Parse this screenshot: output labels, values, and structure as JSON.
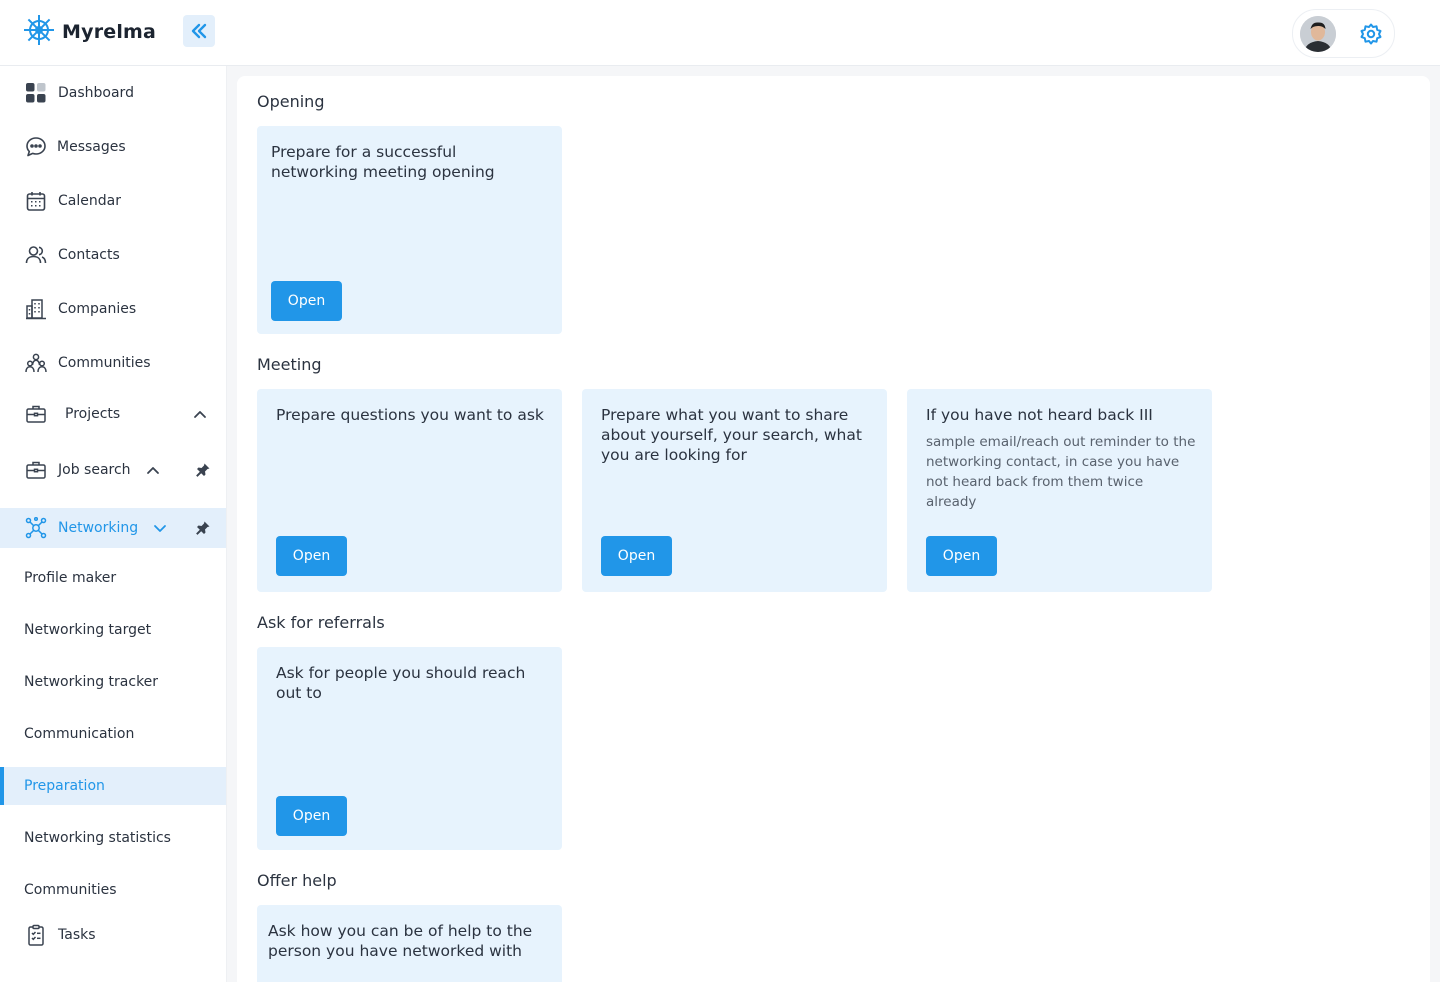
{
  "app": {
    "name": "Myrelma"
  },
  "colors": {
    "accent": "#2196e8",
    "accent_light": "#e3effb",
    "card_bg": "#e7f3fd"
  },
  "sidebar": {
    "items": [
      {
        "label": "Dashboard",
        "icon": "dashboard-icon"
      },
      {
        "label": "Messages",
        "icon": "chat-bubble-icon"
      },
      {
        "label": "Calendar",
        "icon": "calendar-icon"
      },
      {
        "label": "Contacts",
        "icon": "users-icon"
      },
      {
        "label": "Companies",
        "icon": "building-icon"
      },
      {
        "label": "Communities",
        "icon": "community-icon"
      },
      {
        "label": "Projects",
        "icon": "briefcase-icon"
      },
      {
        "label": "Job search",
        "icon": "briefcase-icon"
      },
      {
        "label": "Networking",
        "icon": "network-icon"
      }
    ],
    "networking_sub": [
      "Profile maker",
      "Networking target",
      "Networking tracker",
      "Communication",
      "Preparation",
      "Networking statistics",
      "Communities"
    ],
    "tasks": {
      "label": "Tasks",
      "icon": "clipboard-checklist-icon"
    }
  },
  "sections": [
    {
      "title": "Opening",
      "cards": [
        {
          "title": "Prepare for a successful networking meeting opening",
          "description": "",
          "button": "Open"
        }
      ]
    },
    {
      "title": "Meeting",
      "cards": [
        {
          "title": "Prepare questions you want to ask",
          "description": "",
          "button": "Open"
        },
        {
          "title": "Prepare what you want to share about yourself, your search, what you are looking for",
          "description": "",
          "button": "Open"
        },
        {
          "title": "If you have not heard back III",
          "description": "sample email/reach out reminder to the networking contact, in case you have not heard back from them twice already",
          "button": "Open"
        }
      ]
    },
    {
      "title": "Ask for referrals",
      "cards": [
        {
          "title": "Ask for people you should reach out to",
          "description": "",
          "button": "Open"
        }
      ]
    },
    {
      "title": "Offer help",
      "cards": [
        {
          "title": "Ask how you can be of help to the person you have networked with",
          "description": ""
        }
      ]
    }
  ]
}
